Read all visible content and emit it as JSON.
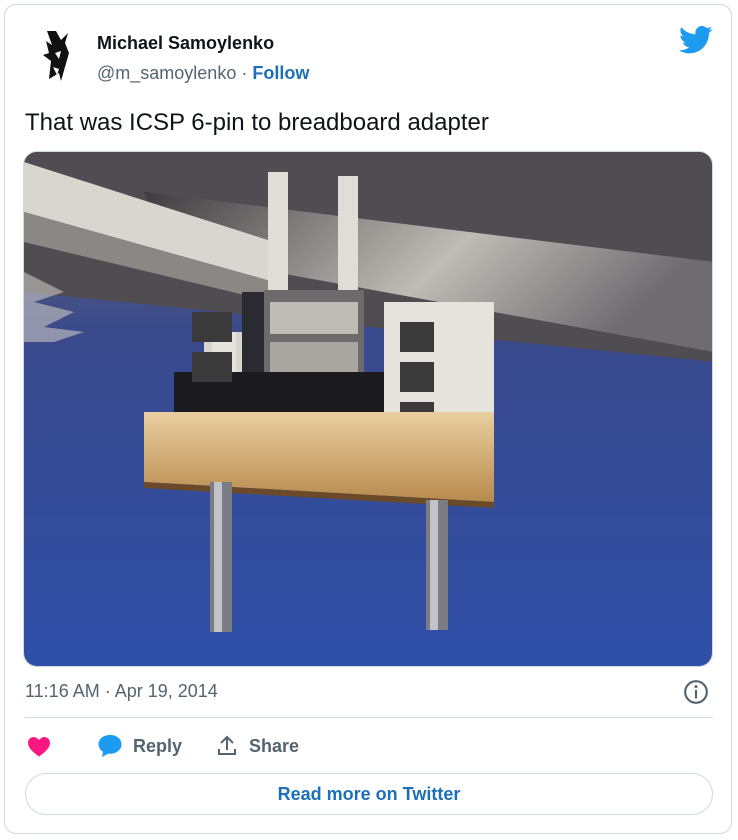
{
  "author": {
    "name": "Michael Samoylenko",
    "handle": "@m_samoylenko",
    "separator": " · ",
    "follow_label": "Follow"
  },
  "tweet": {
    "text": "That was ICSP 6-pin to breadboard adapter",
    "timestamp": "11:16 AM · Apr 19, 2014"
  },
  "actions": {
    "like_label": "",
    "reply_label": "Reply",
    "share_label": "Share"
  },
  "footer": {
    "read_more_label": "Read more on Twitter"
  },
  "icons": {
    "brand": "twitter-bird-icon",
    "like": "heart-icon",
    "reply": "speech-bubble-icon",
    "share": "upload-icon",
    "info": "info-icon"
  },
  "colors": {
    "twitter_blue": "#1d9bf0",
    "link_blue": "#1d70b8",
    "like_pink": "#f91880",
    "muted_text": "#536471"
  }
}
